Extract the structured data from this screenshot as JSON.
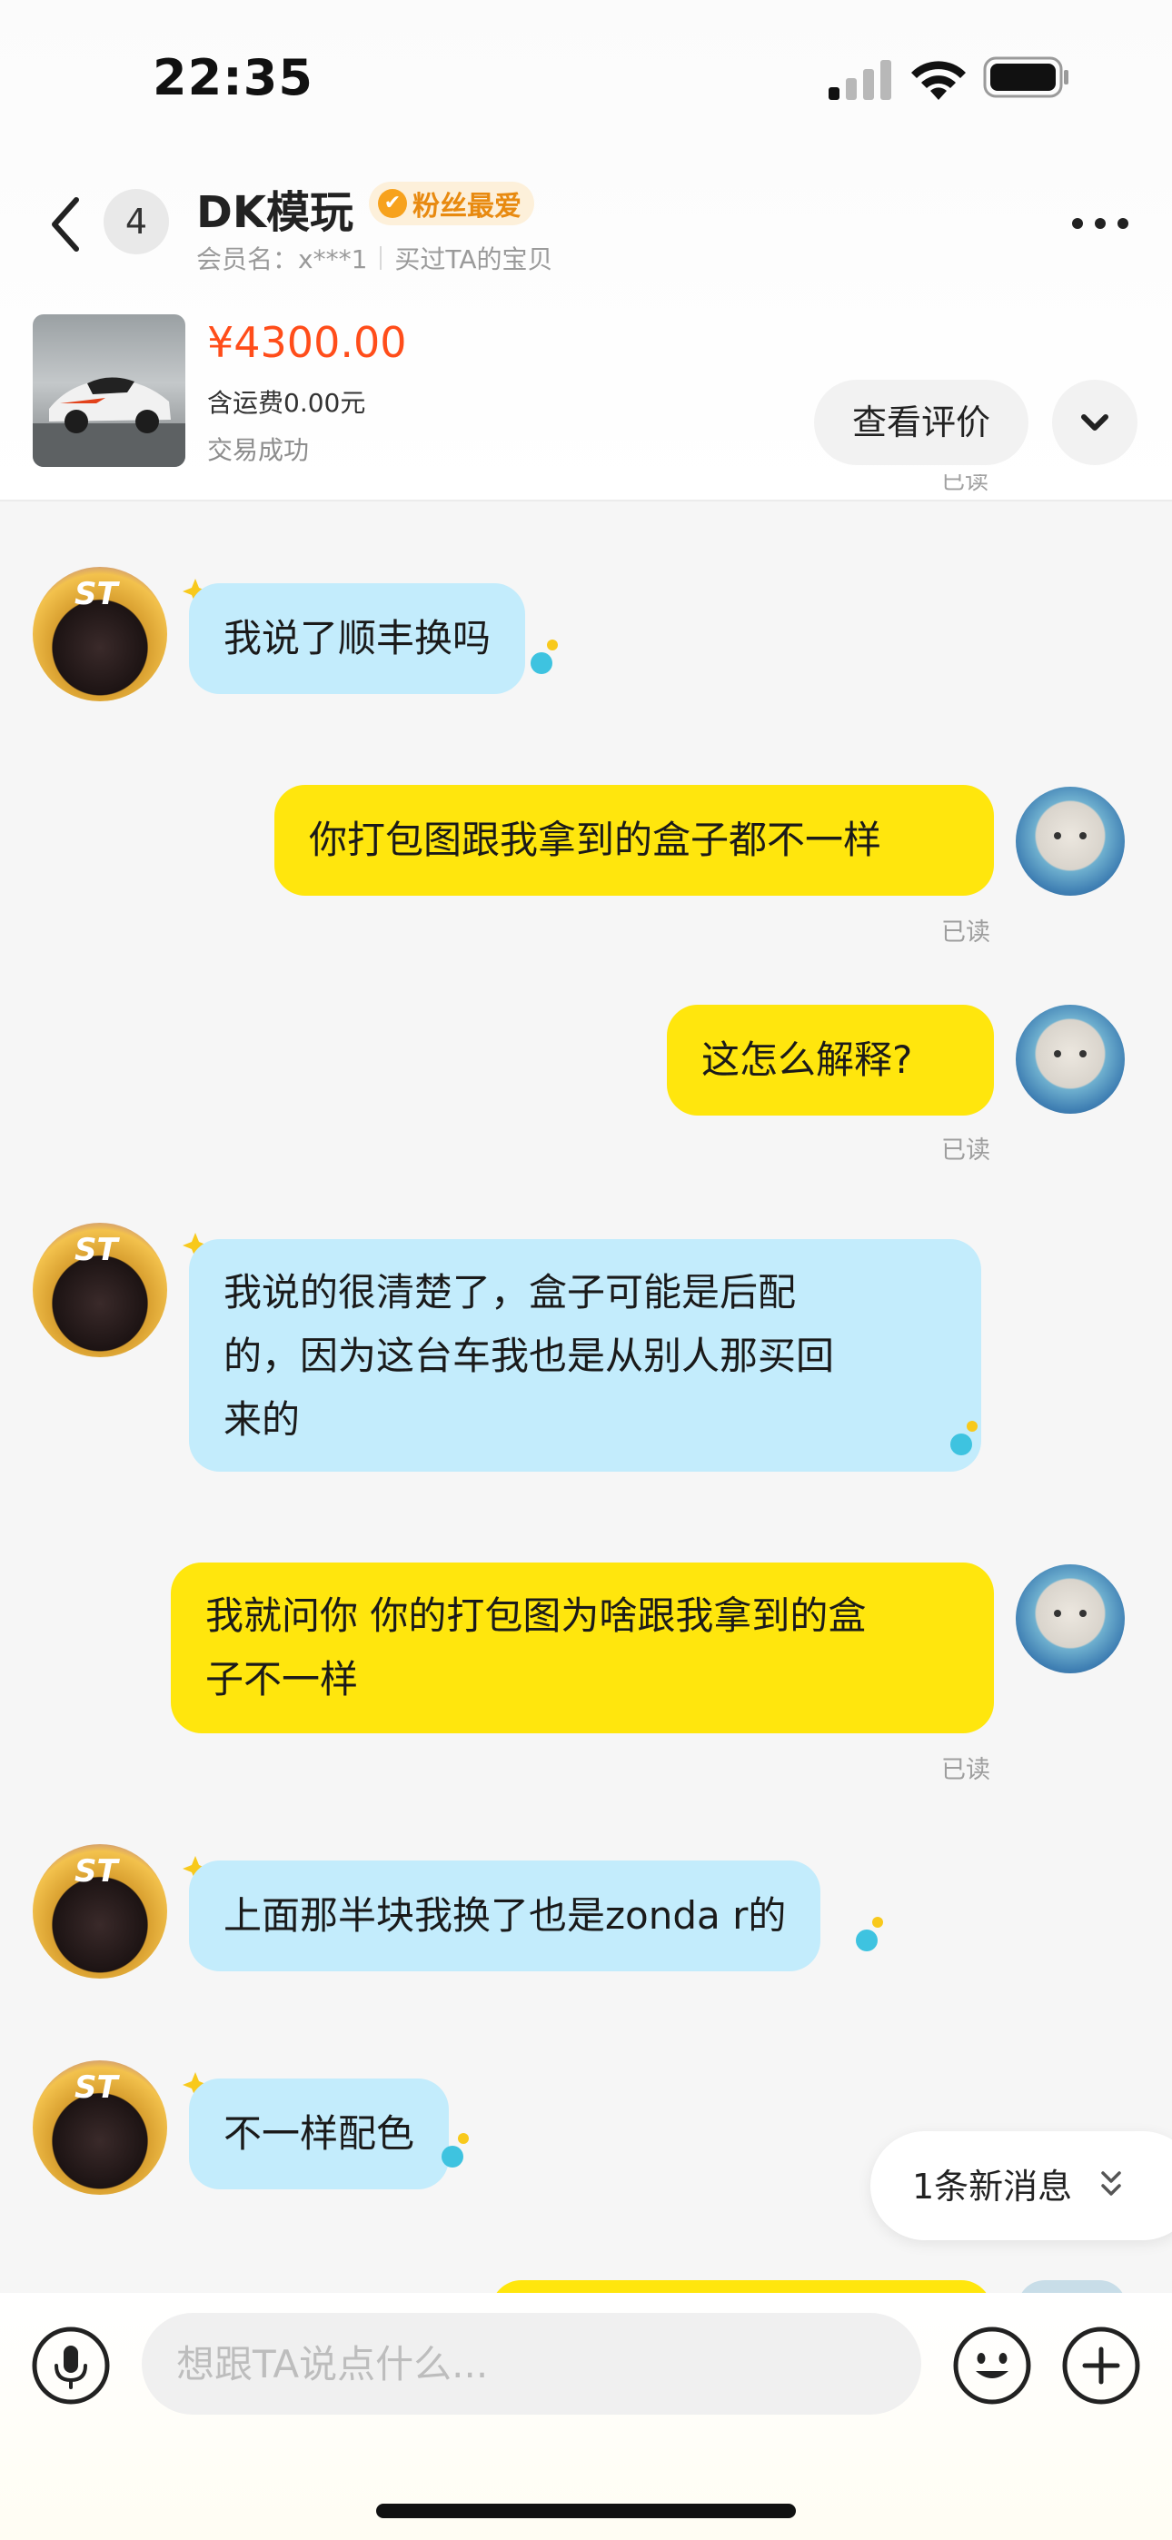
{
  "status_bar": {
    "time": "22:35"
  },
  "header": {
    "unread_count": "4",
    "shop_name": "DK模玩",
    "fan_badge": "粉丝最爱",
    "member_name": "会员名：x***1",
    "purchase_note": "买过TA的宝贝"
  },
  "product": {
    "price": "¥4300.00",
    "shipping": "含运费0.00元",
    "status": "交易成功",
    "review_button": "查看评价"
  },
  "chat": {
    "top_read_fragment": "已读",
    "messages": [
      {
        "side": "seller",
        "text": "我说了顺丰换吗"
      },
      {
        "side": "buyer",
        "text": "你打包图跟我拿到的盒子都不一样",
        "status": "已读"
      },
      {
        "side": "buyer",
        "text": "这怎么解释?",
        "status": "已读"
      },
      {
        "side": "seller",
        "text": "我说的很清楚了，盒子可能是后配\n的，因为这台车我也是从别人那买回\n来的"
      },
      {
        "side": "buyer",
        "text": "我就问你 你的打包图为啥跟我拿到的盒\n子不一样",
        "status": "已读"
      },
      {
        "side": "seller",
        "text": "上面那半块我换了也是zonda r的"
      },
      {
        "side": "seller",
        "text": "不一样配色"
      }
    ],
    "new_messages_pill": "1条新消息"
  },
  "input_bar": {
    "placeholder": "想跟TA说点什么..."
  },
  "colors": {
    "price": "#ff4d1a",
    "incoming_bubble": "#c3ecfc",
    "outgoing_bubble": "#ffe60d",
    "badge_text": "#e88a10"
  }
}
